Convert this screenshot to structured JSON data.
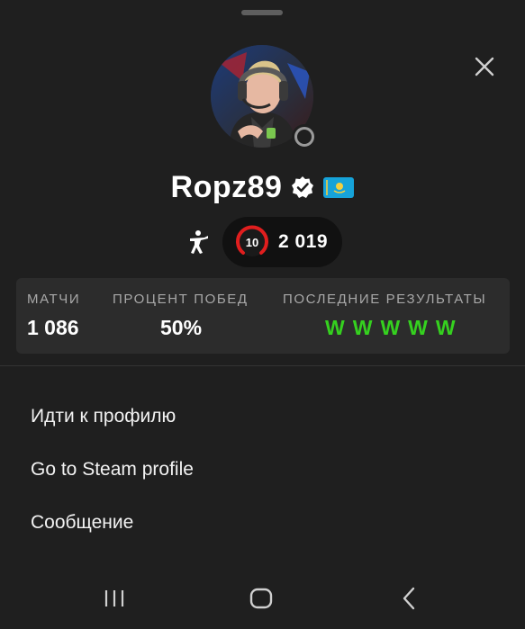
{
  "profile": {
    "username": "Ropz89",
    "avatar_alt": "player avatar",
    "verified": true,
    "country_flag": "kz-flag-icon",
    "status": "offline"
  },
  "game": {
    "icon": "counter-strike-icon",
    "level": "10",
    "elo": "2 019"
  },
  "stats": {
    "matches_label": "МАТЧИ",
    "matches_value": "1 086",
    "winrate_label": "ПРОЦЕНТ ПОБЕД",
    "winrate_value": "50%",
    "recent_label": "ПОСЛЕДНИЕ РЕЗУЛЬТАТЫ",
    "recent_results": [
      "W",
      "W",
      "W",
      "W",
      "W"
    ]
  },
  "menu": {
    "go_to_profile": "Идти к профилю",
    "go_to_steam": "Go to Steam profile",
    "message": "Сообщение"
  },
  "colors": {
    "background": "#1f1f1f",
    "card": "#2c2c2c",
    "win": "#35d11f",
    "level_red": "#e01e1e"
  }
}
